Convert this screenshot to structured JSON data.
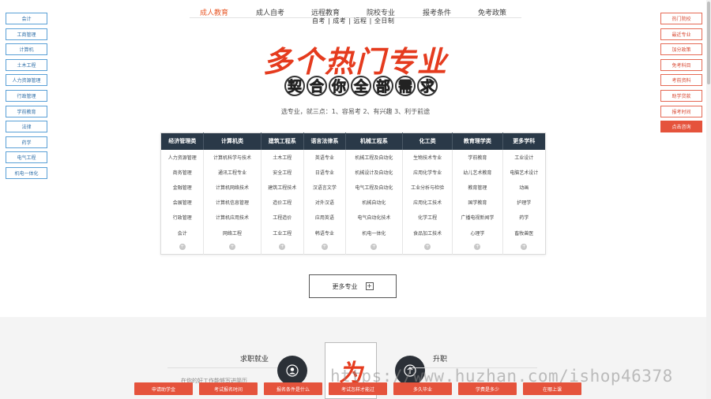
{
  "topnav": {
    "items": [
      "成人教育",
      "成人自考",
      "远程教育",
      "院校专业",
      "报考条件",
      "免考政策"
    ],
    "active_index": 0,
    "sub_label": "自考 | 成考 | 远程 | 全日制"
  },
  "left_sidebar": [
    "会计",
    "工商管理",
    "计算机",
    "土木工程",
    "人力资源管理",
    "行政管理",
    "学前教育",
    "法律",
    "药学",
    "电气工程",
    "机电一体化"
  ],
  "right_sidebar": [
    "热门院校",
    "最近专业",
    "加分政策",
    "免考科目",
    "考前资料",
    "助学贷款",
    "报考时间",
    "点击咨询"
  ],
  "hero": {
    "title": "多个热门专业",
    "subtitle_chars": [
      "契",
      "合",
      "你",
      "全",
      "部",
      "需",
      "求"
    ],
    "tip": "选专业，就三点：1、容易考 2、有兴趣 3、利于前途"
  },
  "majors": {
    "headers": [
      "经济管理类",
      "计算机类",
      "建筑工程系",
      "语言法律系",
      "机械工程系",
      "化工类",
      "教育理学类",
      "更多学科"
    ],
    "rows": [
      [
        "人力资源管理",
        "计算机科学与技术",
        "土木工程",
        "英语专业",
        "机械工程及自动化",
        "生物技术专业",
        "学前教育",
        "工业设计"
      ],
      [
        "商务管理",
        "通讯工程专业",
        "安全工程",
        "日语专业",
        "机械设计及自动化",
        "应用化学专业",
        "幼儿艺术教育",
        "电脑艺术设计"
      ],
      [
        "金融管理",
        "计算机网络技术",
        "建筑工程技术",
        "汉语言文学",
        "电气工程及自动化",
        "工业分析与检验",
        "教育管理",
        "动画"
      ],
      [
        "会展管理",
        "计算机信息管理",
        "造价工程",
        "对外汉语",
        "机械自动化",
        "应用化工技术",
        "国学教育",
        "护理学"
      ],
      [
        "行政管理",
        "计算机应用技术",
        "工程造价",
        "应用英语",
        "电气自动化技术",
        "化学工程",
        "广播电视新闻学",
        "药学"
      ],
      [
        "会计",
        "网络工程",
        "工业工程",
        "韩语专业",
        "机电一体化",
        "食品加工技术",
        "心理学",
        "畜牧兽医"
      ]
    ],
    "more_row_symbol": "+"
  },
  "more_button": {
    "label": "更多专业",
    "icon": "+"
  },
  "lower": {
    "career_label": "求职就业",
    "career_text": "在你的好工作能够写进简历",
    "promote_label": "升职",
    "logo_char": "为",
    "icons": [
      "user-icon",
      "promotion-icon"
    ]
  },
  "watermark": "https://www.huzhan.com/ishop46378",
  "bottom_bar": [
    "申请助学金",
    "考试报名时间",
    "报名条件是什么",
    "考试怎样才能过",
    "多久毕业",
    "学费是多少",
    "在哪上课"
  ],
  "colors": {
    "accent": "#e5533c",
    "nav_active": "#e85a2a",
    "table_header": "#2a3948",
    "sidebar_border": "#5aa0d6"
  }
}
